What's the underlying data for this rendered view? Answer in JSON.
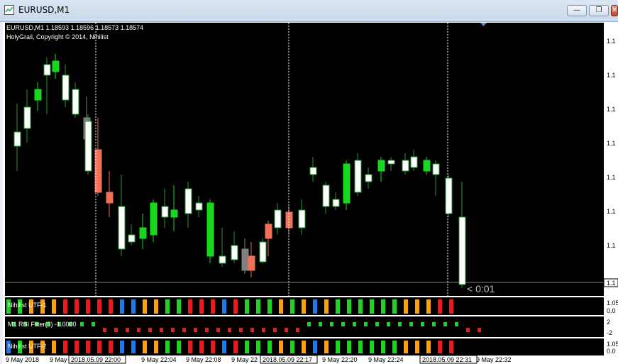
{
  "window": {
    "title": "EURUSD,M1",
    "minimize": "—",
    "restore": "❐",
    "close": "✕"
  },
  "main": {
    "header": "EURUSD,M1  1.18593 1.18596 1.18573 1.18574",
    "indicator": "HolyGrail, Copyright © 2014, Nihilist",
    "timer": "< 0:01",
    "price_labels": [
      "1.1",
      "1.1",
      "1.1",
      "1.1",
      "1.1",
      "1.1",
      "1.1",
      "1.1"
    ],
    "current_price": "1.1"
  },
  "subwindows": [
    {
      "name": "Nihilist UTF-1",
      "scale": [
        "1.05",
        "0.0"
      ]
    },
    {
      "name": "M1 RSI Filter(3) -1.0000",
      "scale": [
        "2",
        "-2"
      ]
    },
    {
      "name": "Nihilist UTF-2",
      "scale": [
        "1.05",
        "0.0"
      ]
    }
  ],
  "time_axis": [
    "9 May 2018",
    "9 May 22:00",
    "9 May 22:04",
    "9 May 22:08",
    "9 May 22",
    "9 May 22:20",
    "9 May 22:24",
    "9 May 22:32"
  ],
  "time_boxes": [
    "2018.05.09 22:00",
    "2018.05.09 22:17",
    "2018.05.09 22:31"
  ],
  "colors": {
    "background": "#000000",
    "bull_fill": "#ffffff",
    "bull_outline": "#1f9a2c",
    "bear": "#f07058",
    "green": "#17d81f",
    "red": "#f01818",
    "orange": "#ffa010",
    "blue": "#1e7ae8"
  },
  "chart_data": {
    "type": "candlestick",
    "title": "EURUSD,M1",
    "candles": [
      {
        "c": "w"
      },
      {
        "c": "w"
      },
      {
        "c": "g"
      },
      {
        "c": "w"
      },
      {
        "c": "g"
      },
      {
        "c": "w"
      },
      {
        "c": "w"
      },
      {
        "c": "gr"
      },
      {
        "c": "w"
      },
      {
        "c": "r"
      },
      {
        "c": "r"
      },
      {
        "c": "w"
      },
      {
        "c": "w"
      },
      {
        "c": "g"
      },
      {
        "c": "g"
      },
      {
        "c": "w"
      },
      {
        "c": "g"
      },
      {
        "c": "w"
      },
      {
        "c": "w"
      },
      {
        "c": "g"
      },
      {
        "c": "w"
      },
      {
        "c": "w"
      },
      {
        "c": "gr"
      },
      {
        "c": "r"
      },
      {
        "c": "w"
      },
      {
        "c": "r"
      },
      {
        "c": "w"
      },
      {
        "c": "r"
      },
      {
        "c": "w"
      },
      {
        "c": "w"
      },
      {
        "c": "w"
      },
      {
        "c": "w"
      },
      {
        "c": "g"
      },
      {
        "c": "w"
      },
      {
        "c": "w"
      },
      {
        "c": "g"
      },
      {
        "c": "w"
      },
      {
        "c": "w"
      },
      {
        "c": "w"
      },
      {
        "c": "g"
      },
      {
        "c": "w"
      },
      {
        "c": "w"
      },
      {
        "c": "w"
      },
      {
        "c": "w"
      },
      {
        "c": "w"
      },
      {
        "c": "g"
      },
      {
        "c": "w"
      },
      {
        "c": "w"
      },
      {
        "c": "w"
      },
      {
        "c": "r"
      },
      {
        "c": "w"
      },
      {
        "c": "r"
      }
    ],
    "utf1_colors": [
      "green",
      "green",
      "orange",
      "orange",
      "orange",
      "red",
      "red",
      "red",
      "red",
      "red",
      "blue",
      "blue",
      "orange",
      "orange",
      "green",
      "green",
      "red",
      "red",
      "red",
      "blue",
      "red",
      "green",
      "green",
      "green",
      "orange",
      "green",
      "orange",
      "blue",
      "orange",
      "green",
      "green",
      "green",
      "green",
      "green",
      "green",
      "orange",
      "orange",
      "orange",
      "red",
      "red"
    ],
    "rsi_dots": [
      {
        "y": "top",
        "c": "green"
      },
      {
        "y": "top",
        "c": "green"
      },
      {
        "y": "top",
        "c": "green"
      },
      {
        "y": "top",
        "c": "green"
      },
      {
        "y": "top",
        "c": "green"
      },
      {
        "y": "top",
        "c": "green"
      },
      {
        "y": "top",
        "c": "green"
      },
      {
        "y": "top",
        "c": "green"
      },
      {
        "y": "bot",
        "c": "red"
      },
      {
        "y": "bot",
        "c": "red"
      },
      {
        "y": "bot",
        "c": "red"
      },
      {
        "y": "bot",
        "c": "red"
      },
      {
        "y": "bot",
        "c": "red"
      },
      {
        "y": "bot",
        "c": "red"
      },
      {
        "y": "bot",
        "c": "red"
      },
      {
        "y": "bot",
        "c": "red"
      },
      {
        "y": "bot",
        "c": "red"
      },
      {
        "y": "bot",
        "c": "red"
      },
      {
        "y": "bot",
        "c": "red"
      },
      {
        "y": "bot",
        "c": "red"
      },
      {
        "y": "bot",
        "c": "red"
      },
      {
        "y": "bot",
        "c": "red"
      },
      {
        "y": "bot",
        "c": "red"
      },
      {
        "y": "bot",
        "c": "red"
      },
      {
        "y": "bot",
        "c": "red"
      },
      {
        "y": "bot",
        "c": "red"
      },
      {
        "y": "top",
        "c": "green"
      },
      {
        "y": "top",
        "c": "green"
      },
      {
        "y": "top",
        "c": "green"
      },
      {
        "y": "top",
        "c": "green"
      },
      {
        "y": "top",
        "c": "green"
      },
      {
        "y": "top",
        "c": "green"
      },
      {
        "y": "top",
        "c": "green"
      },
      {
        "y": "top",
        "c": "green"
      },
      {
        "y": "top",
        "c": "green"
      },
      {
        "y": "top",
        "c": "green"
      },
      {
        "y": "top",
        "c": "green"
      },
      {
        "y": "top",
        "c": "green"
      },
      {
        "y": "top",
        "c": "green"
      },
      {
        "y": "top",
        "c": "green"
      },
      {
        "y": "bot",
        "c": "red"
      },
      {
        "y": "bot",
        "c": "red"
      }
    ],
    "utf2_colors": [
      "blue",
      "green",
      "orange",
      "orange",
      "orange",
      "red",
      "red",
      "red",
      "red",
      "red",
      "blue",
      "blue",
      "orange",
      "orange",
      "green",
      "green",
      "red",
      "red",
      "red",
      "blue",
      "red",
      "green",
      "green",
      "green",
      "orange",
      "green",
      "orange",
      "blue",
      "orange",
      "green",
      "green",
      "green",
      "green",
      "green",
      "green",
      "orange",
      "orange",
      "orange",
      "red",
      "red"
    ]
  }
}
